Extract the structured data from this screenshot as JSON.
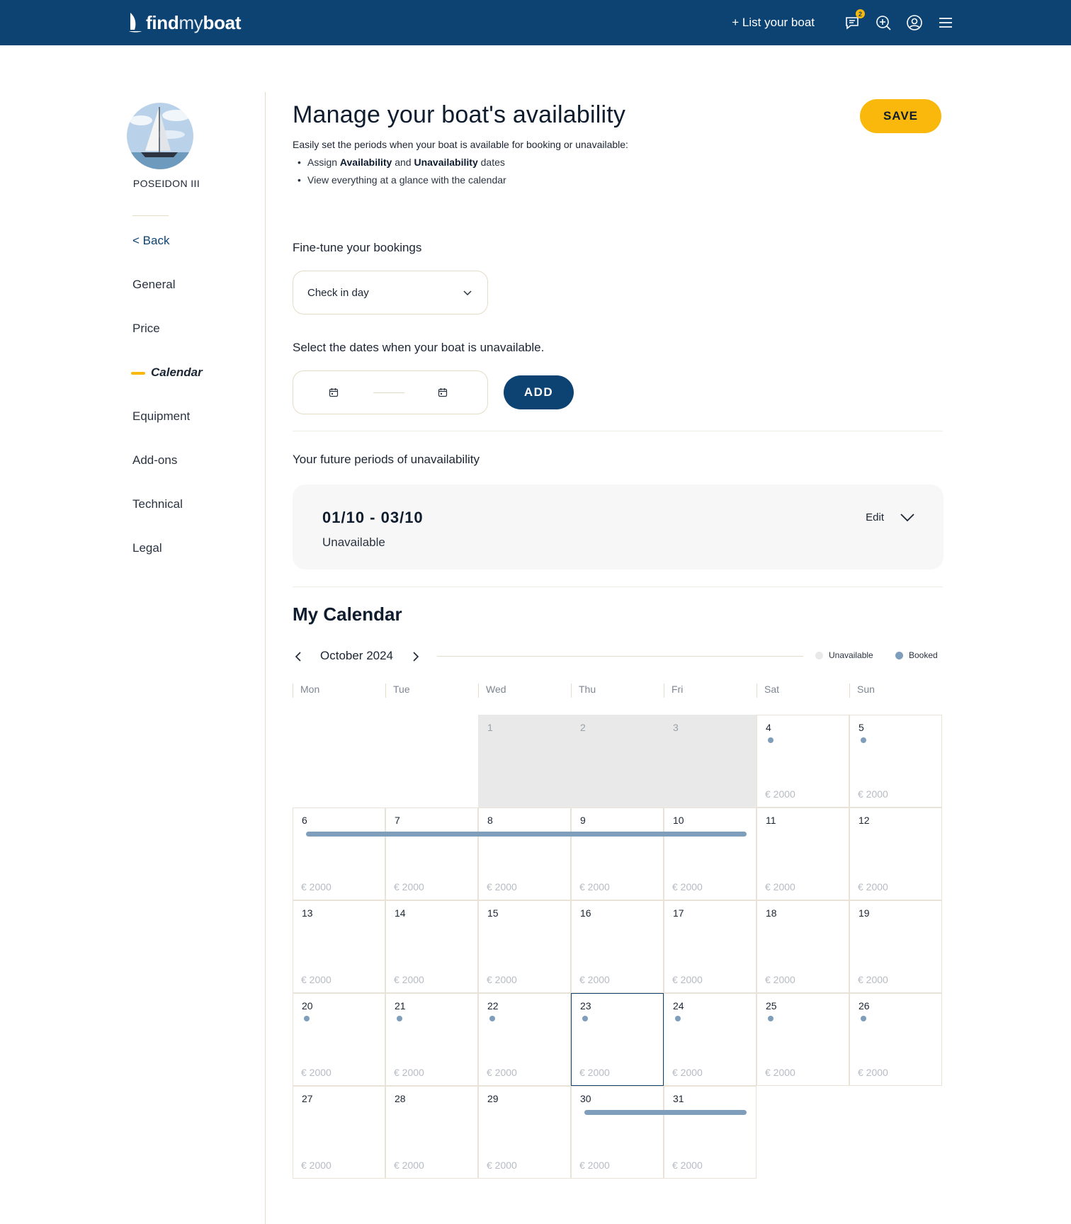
{
  "header": {
    "logo_bold": "find",
    "logo_thin": "my",
    "logo_end": "boat",
    "list_boat": "+ List your boat",
    "messages_badge": "2",
    "icons": [
      "chat-icon",
      "add-search-icon",
      "user-icon",
      "menu-icon"
    ]
  },
  "boat": {
    "name": "POSEIDON III"
  },
  "sidebar": {
    "back": "< Back",
    "items": [
      "General",
      "Price",
      "Calendar",
      "Equipment",
      "Add-ons",
      "Technical",
      "Legal"
    ],
    "active": "Calendar"
  },
  "page": {
    "title": "Manage your boat's availability",
    "save": "SAVE",
    "intro": "Easily set the periods when your boat is available for booking or unavailable:",
    "bullet1_pre": "Assign ",
    "bullet1_b1": "Availability",
    "bullet1_mid": " and ",
    "bullet1_b2": "Unavailability",
    "bullet1_post": " dates",
    "bullet2": "View everything at a glance with the calendar"
  },
  "bookings": {
    "label": "Fine-tune your bookings",
    "select_value": "Check in day"
  },
  "unavailable_select": {
    "label": "Select the dates when your boat is unavailable.",
    "add": "ADD"
  },
  "future": {
    "label": "Your future periods of unavailability",
    "periods": [
      {
        "dates": "01/10 - 03/10",
        "status": "Unavailable",
        "edit": "Edit"
      }
    ]
  },
  "calendar": {
    "title": "My Calendar",
    "month": "October 2024",
    "legend": {
      "unavailable": "Unavailable",
      "booked": "Booked"
    },
    "colors": {
      "unavailable": "#e9e9e9",
      "booked": "#7f9ebb",
      "accent": "#f9b80b",
      "brand": "#0c4373"
    },
    "weekdays": [
      "Mon",
      "Tue",
      "Wed",
      "Thu",
      "Fri",
      "Sat",
      "Sun"
    ],
    "first_weekday_index": 2,
    "days_in_month": 31,
    "price_label": "€ 2000",
    "today": 23,
    "unavailable_days": [
      1,
      2,
      3
    ],
    "unpriced_days": [
      1,
      2,
      3
    ],
    "booked_dot_days": [
      4,
      5,
      20,
      21,
      22,
      23,
      24,
      25,
      26
    ],
    "booked_ranges": [
      [
        6,
        10
      ],
      [
        30,
        31
      ]
    ]
  }
}
